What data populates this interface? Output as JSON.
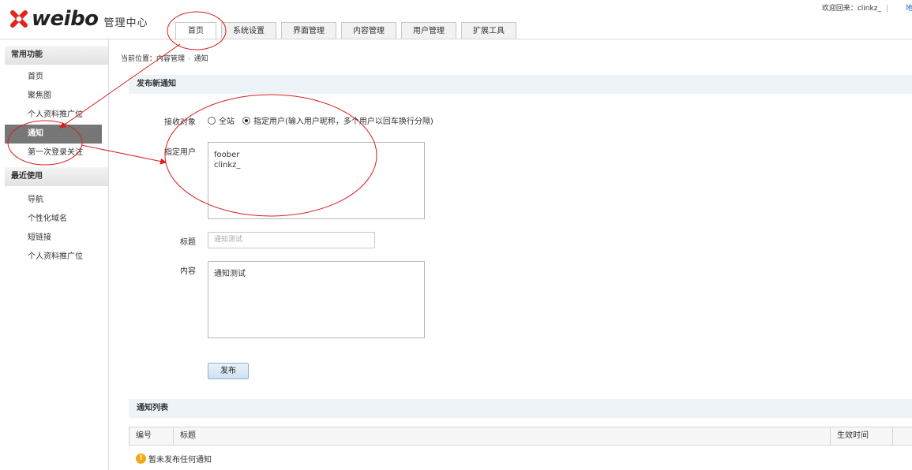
{
  "header": {
    "logo_text": "weibo",
    "logo_subtitle": "管理中心",
    "welcome_text": "欢迎回来：clinkz_",
    "map_link": "地图导"
  },
  "tabs": [
    {
      "label": "首页",
      "active": true
    },
    {
      "label": "系统设置",
      "active": false
    },
    {
      "label": "界面管理",
      "active": false
    },
    {
      "label": "内容管理",
      "active": false
    },
    {
      "label": "用户管理",
      "active": false
    },
    {
      "label": "扩展工具",
      "active": false
    }
  ],
  "sidebar": {
    "common_title": "常用功能",
    "common_items": [
      "首页",
      "聚焦图",
      "个人资料推广位",
      "通知",
      "第一次登录关注"
    ],
    "active_item": "通知",
    "recent_title": "最近使用",
    "recent_items": [
      "导航",
      "个性化域名",
      "短链接",
      "个人资料推广位"
    ]
  },
  "breadcrumb": {
    "prefix": "当前位置：",
    "parent": "内容管理",
    "current": "通知"
  },
  "publish_form": {
    "section_title": "发布新通知",
    "recipient_label": "接收对象",
    "option_all": "全站",
    "option_specified": "指定用户(输入用户昵称，多个用户以回车换行分隔)",
    "selected_option": "specified",
    "users_label": "指定用户",
    "users_value": [
      "foober",
      "clinkz_"
    ],
    "title_label": "标题",
    "title_placeholder": "通知测试",
    "content_label": "内容",
    "content_value": "通知测试",
    "submit_label": "发布"
  },
  "notice_list": {
    "section_title": "通知列表",
    "columns": [
      "编号",
      "标题",
      "生效时间"
    ],
    "empty_message": "暂未发布任何通知"
  },
  "colors": {
    "annotation": "#d81e1e",
    "section_bar": "#eef3f8",
    "active_sidebar": "#777777",
    "link": "#1a64c8"
  }
}
